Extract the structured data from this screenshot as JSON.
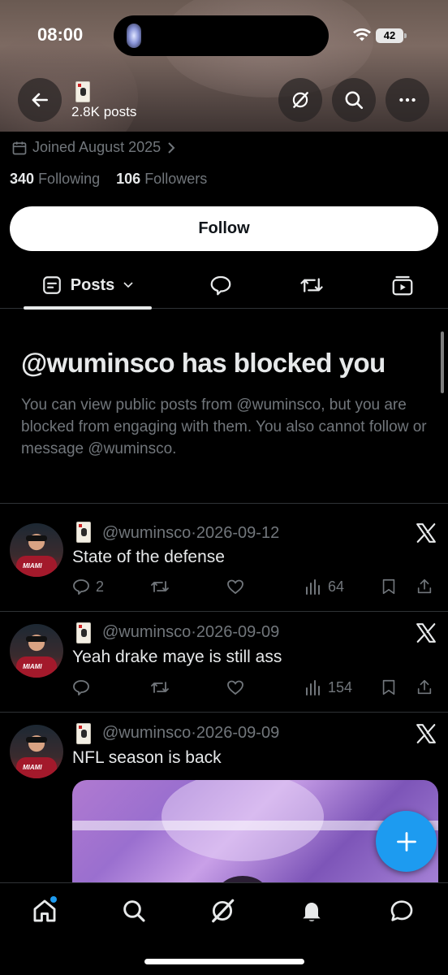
{
  "status_bar": {
    "time": "08:00",
    "battery": "42"
  },
  "header": {
    "posts_count": "2.8K posts"
  },
  "profile": {
    "joined": "Joined August 2025",
    "following_count": "340",
    "following_label": "Following",
    "followers_count": "106",
    "followers_label": "Followers",
    "follow_label": "Follow"
  },
  "tabs": {
    "posts_label": "Posts"
  },
  "blocked": {
    "title": "@wuminsco has blocked you",
    "message": "You can view public posts from @wuminsco, but you are blocked from engaging with them. You also cannot follow or message @wuminsco."
  },
  "tweets": [
    {
      "handle": "@wuminsco",
      "sep": "·",
      "date": "2026-09-12",
      "text": "State of the defense",
      "replies": "2",
      "views": "64"
    },
    {
      "handle": "@wuminsco",
      "sep": "·",
      "date": "2026-09-09",
      "text": "Yeah drake maye is still ass",
      "replies": "",
      "views": "154"
    },
    {
      "handle": "@wuminsco",
      "sep": "·",
      "date": "2026-09-09",
      "text": "NFL season is back"
    }
  ],
  "avatar_text": "MIAMI",
  "colors": {
    "accent": "#1d9bf0",
    "muted": "#71767b",
    "text": "#e7e9ea",
    "background": "#000000"
  },
  "icons": [
    "back-arrow-icon",
    "grok-icon",
    "search-icon",
    "more-icon",
    "calendar-icon",
    "chevron-right-icon",
    "posts-icon",
    "chevron-down-icon",
    "reply-icon",
    "repost-icon",
    "media-icon",
    "like-icon",
    "views-icon",
    "bookmark-icon",
    "share-icon",
    "x-logo-icon",
    "plus-icon",
    "home-icon",
    "notifications-icon",
    "messages-icon"
  ]
}
